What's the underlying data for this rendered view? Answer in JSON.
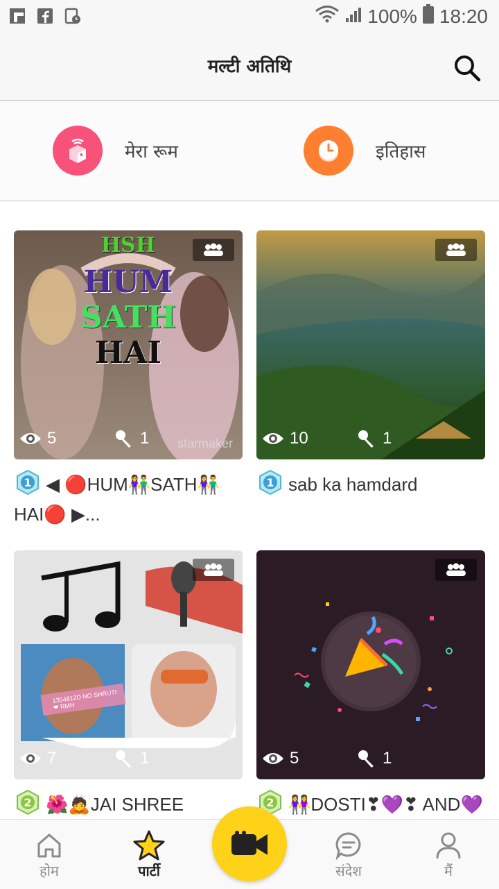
{
  "status_bar": {
    "battery": "100%",
    "time": "18:20"
  },
  "header": {
    "title": "मल्टी अतिथि"
  },
  "quick_actions": [
    {
      "label": "मेरा रूम",
      "color": "#f7527a"
    },
    {
      "label": "इतिहास",
      "color": "#ff7f30"
    }
  ],
  "rooms": [
    {
      "name": "◀ 🔴HUM👫SATH👫 HAI🔴 ▶...",
      "views": "5",
      "mics": "1",
      "level": "1",
      "cover_text": [
        "HSH",
        "HUM",
        "SATH",
        "HAI"
      ],
      "watermark": "starmaker"
    },
    {
      "name": "sab ka hamdard",
      "views": "10",
      "mics": "1",
      "level": "1"
    },
    {
      "name": "🌺🙇JAI SHREE KRISHNA🙇🌺",
      "views": "7",
      "mics": "1",
      "level": "2",
      "cover_text": [
        "1354812D NO SHRUTI❤ RMH"
      ]
    },
    {
      "name": "👭DOSTI❣💜❣ AND💜💜💜MASTI👭",
      "views": "5",
      "mics": "1",
      "level": "2"
    }
  ],
  "bottom_nav": [
    {
      "label": "होम"
    },
    {
      "label": "पार्टी"
    },
    {
      "label": "संदेश"
    },
    {
      "label": "मैं"
    }
  ],
  "accent": "#ffd21a"
}
